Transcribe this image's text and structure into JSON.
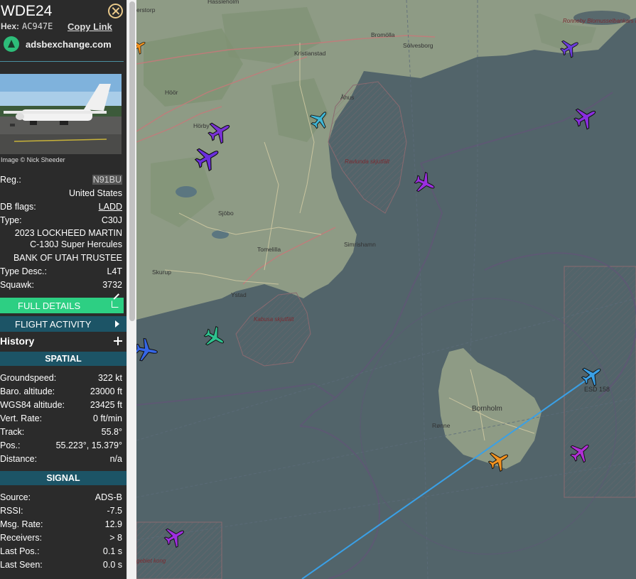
{
  "aircraft": {
    "callsign": "WDE24",
    "hex_label": "Hex:",
    "hex": "AC947E",
    "copy_link": "Copy Link",
    "site": "adsbexchange.com",
    "photo_credit": "Image © Nick Sheeder"
  },
  "details": {
    "reg_label": "Reg.:",
    "reg": "N91BU",
    "country": "United States",
    "dbflags_label": "DB flags:",
    "dbflags": "LADD",
    "type_label": "Type:",
    "type": "C30J",
    "model_line1": "2023 LOCKHEED MARTIN",
    "model_line2": "C-130J Super Hercules",
    "owner": "BANK OF UTAH TRUSTEE",
    "typedesc_label": "Type Desc.:",
    "typedesc": "L4T",
    "squawk_label": "Squawk:",
    "squawk": "3732"
  },
  "buttons": {
    "full_details": "FULL DETAILS",
    "flight_activity": "FLIGHT ACTIVITY",
    "history": "History"
  },
  "spatial": {
    "title": "SPATIAL",
    "rows": [
      {
        "k": "Groundspeed:",
        "v": "322 kt"
      },
      {
        "k": "Baro. altitude:",
        "v": "23000 ft"
      },
      {
        "k": "WGS84 altitude:",
        "v": "23425 ft"
      },
      {
        "k": "Vert. Rate:",
        "v": "0 ft/min"
      },
      {
        "k": "Track:",
        "v": "55.8°"
      },
      {
        "k": "Pos.:",
        "v": "55.223°, 15.379°"
      },
      {
        "k": "Distance:",
        "v": "n/a"
      }
    ]
  },
  "signal": {
    "title": "SIGNAL",
    "rows": [
      {
        "k": "Source:",
        "v": "ADS-B"
      },
      {
        "k": "RSSI:",
        "v": "-7.5"
      },
      {
        "k": "Msg. Rate:",
        "v": "12.9"
      },
      {
        "k": "Receivers:",
        "v": "> 8"
      },
      {
        "k": "Last Pos.:",
        "v": "0.1 s"
      },
      {
        "k": "Last Seen:",
        "v": "0.0 s"
      }
    ]
  },
  "map": {
    "places": [
      "Hässleholm",
      "Bromölla",
      "Kristianstad",
      "Sölvesborg",
      "Hörby",
      "Åhus",
      "Höör",
      "Sjöbo",
      "Tomelilla",
      "Simrishamn",
      "Skurup",
      "Ystad",
      "Bornholm",
      "Rønne",
      "erstorp"
    ],
    "zones": [
      "Ravlunda skjutfält",
      "Kabusa skjutfält",
      "Ronneby Blomusselbankars naturreservat",
      "gebiet kong"
    ],
    "selected_label": "ESD 158",
    "colors": {
      "land": "#8e9b85",
      "sea": "#52646a",
      "selected_track": "#3aa0e6"
    }
  }
}
